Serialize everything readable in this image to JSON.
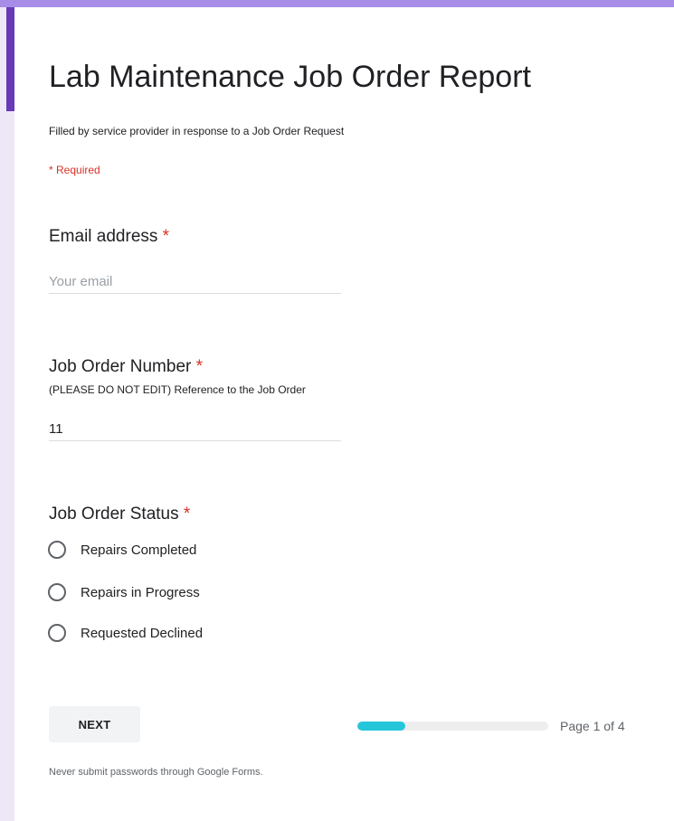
{
  "form": {
    "title": "Lab Maintenance Job Order Report",
    "description": "Filled by service provider in response to a Job Order Request",
    "required_note": "* Required"
  },
  "questions": {
    "email": {
      "label": "Email address",
      "required_mark": "*",
      "placeholder": "Your email",
      "value": ""
    },
    "job_order_number": {
      "label": "Job Order Number",
      "required_mark": "*",
      "help": "(PLEASE DO NOT EDIT) Reference to the Job Order",
      "value": "11"
    },
    "job_order_status": {
      "label": "Job Order Status",
      "required_mark": "*",
      "options": [
        "Repairs Completed",
        "Repairs in Progress",
        "Requested Declined"
      ]
    }
  },
  "navigation": {
    "next_label": "NEXT",
    "page_label": "Page 1 of 4",
    "progress_fraction": 0.25
  },
  "footer": {
    "note": "Never submit passwords through Google Forms."
  },
  "colors": {
    "accent": "#673ab7",
    "required": "#d93025",
    "progress": "#26c6da"
  }
}
